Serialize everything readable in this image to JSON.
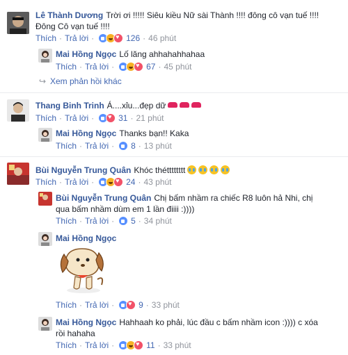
{
  "comments": [
    {
      "name": "Lê Thành Dương",
      "text_line1": "Trời ơi !!!!! Siêu kiều Nữ sài Thành !!!! đông cô vạn tuế !!!!",
      "text_line2": "Đông Cô vạn tuế !!!!",
      "like": "Thích",
      "reply": "Trả lời",
      "reactions": "126",
      "time": "46 phút",
      "replies": [
        {
          "name": "Mai Hồng Ngọc",
          "text": "Lố lăng ahhahahhahaa",
          "like": "Thích",
          "reply": "Trả lời",
          "reactions": "67",
          "time": "45 phút"
        }
      ],
      "more_replies": "Xem phản hồi khác"
    },
    {
      "name": "Thang Binh Trinh",
      "text": "Á....xỉu...đẹp dữ",
      "like": "Thích",
      "reply": "Trả lời",
      "reactions": "31",
      "time": "21 phút",
      "replies": [
        {
          "name": "Mai Hồng Ngọc",
          "text": "Thanks bạn!! Kaka",
          "like": "Thích",
          "reply": "Trả lời",
          "reactions": "8",
          "time": "13 phút"
        }
      ]
    },
    {
      "name": "Bùi Nguyễn Trung Quân",
      "text": "Khóc thétttttttt",
      "like": "Thích",
      "reply": "Trả lời",
      "reactions": "24",
      "time": "43 phút",
      "replies": [
        {
          "name": "Bùi Nguyễn Trung Quân",
          "text_line1": "Chị bấm nhầm ra chiếc R8 luôn hả Nhi, chị",
          "text_line2": "qua bấm nhầm dùm em 1 lần điiii :))))",
          "like": "Thích",
          "reply": "Trả lời",
          "reactions": "5",
          "time": "34 phút"
        },
        {
          "name": "Mai Hồng Ngọc",
          "like": "Thích",
          "reply": "Trả lời",
          "reactions": "9",
          "time": "33 phút"
        },
        {
          "name": "Mai Hồng Ngọc",
          "text_line1": "Hahhaah ko phải, lúc đầu c bấm nhầm icon :)))) c xóa",
          "text_line2": "rồi hahaha",
          "like": "Thích",
          "reply": "Trả lời",
          "reactions": "11",
          "time": "33 phút"
        }
      ]
    }
  ]
}
